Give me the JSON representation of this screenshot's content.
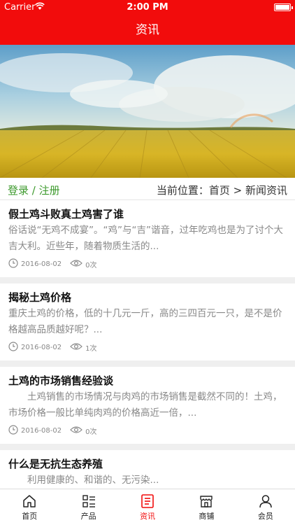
{
  "status": {
    "carrier": "Carrier",
    "time": "2:00 PM"
  },
  "header": {
    "title": "资讯"
  },
  "location": {
    "login": "登录",
    "separator": " / ",
    "register": "注册",
    "prefix": "当前位置：",
    "home": "首页",
    "arrow": " > ",
    "current": "新闻资讯"
  },
  "articles": [
    {
      "title": "假土鸡斗败真土鸡害了谁",
      "summary": "俗话说“无鸡不成宴”。“鸡”与“吉”谐音，过年吃鸡也是为了讨个大吉大利。近些年，随着物质生活的...",
      "date": "2016-08-02",
      "views": "0次"
    },
    {
      "title": "揭秘土鸡价格",
      "summary": "重庆土鸡的价格，低的十几元一斤，高的三四百元一只，是不是价格越高品质越好呢？...",
      "date": "2016-08-02",
      "views": "1次"
    },
    {
      "title": "土鸡的市场销售经验谈",
      "summary": "　　土鸡销售的市场情况与肉鸡的市场销售是截然不同的！土鸡，市场价格一般比单纯肉鸡的价格高近一倍，...",
      "date": "2016-08-02",
      "views": "0次"
    },
    {
      "title": "什么是无抗生态养殖",
      "summary": "　　利用健康的、和谐的、无污染...",
      "date": "",
      "views": ""
    }
  ],
  "tabs": [
    {
      "label": "首页",
      "icon": "home-icon"
    },
    {
      "label": "产品",
      "icon": "list-icon"
    },
    {
      "label": "资讯",
      "icon": "news-icon"
    },
    {
      "label": "商铺",
      "icon": "shop-icon"
    },
    {
      "label": "会员",
      "icon": "user-icon"
    }
  ],
  "colors": {
    "brand": "#f20c0c",
    "accent_green": "#3d9a2d",
    "active_tab": "资讯"
  }
}
